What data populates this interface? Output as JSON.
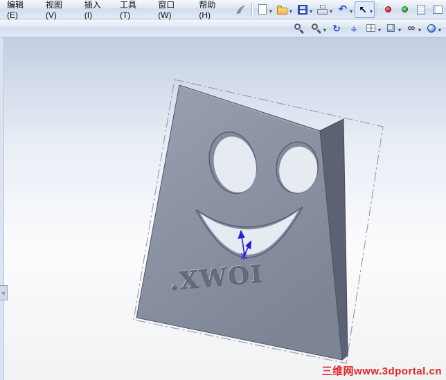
{
  "menu": {
    "items": [
      {
        "name": "menu-edit",
        "label": "编辑(E)"
      },
      {
        "name": "menu-view",
        "label": "视图(V)"
      },
      {
        "name": "menu-insert",
        "label": "插入(I)"
      },
      {
        "name": "menu-tools",
        "label": "工具(T)"
      },
      {
        "name": "menu-window",
        "label": "窗口(W)"
      },
      {
        "name": "menu-help",
        "label": "帮助(H)"
      }
    ]
  },
  "toolbar_main": {
    "group1": [
      {
        "name": "new-document-button",
        "icon": "new-document-icon",
        "cls": "g-page",
        "caret": "▾"
      },
      {
        "name": "open-button",
        "icon": "open-folder-icon",
        "cls": "g-folder",
        "caret": "▾"
      },
      {
        "name": "save-button",
        "icon": "save-floppy-icon",
        "cls": "g-floppy",
        "caret": "▾"
      },
      {
        "name": "print-button",
        "icon": "print-icon",
        "cls": "g-printer",
        "caret": "▾"
      },
      {
        "name": "undo-button",
        "icon": "undo-arrow-icon",
        "cls": "g-undo",
        "caret": "▾"
      },
      {
        "name": "select-button",
        "icon": "select-cursor-icon",
        "cls": "g-cursor",
        "caret": "▾",
        "state": "active"
      }
    ],
    "group2": [
      {
        "name": "rebuild-stop-button",
        "icon": "red-dot-icon",
        "cls": "g-reddot"
      },
      {
        "name": "rebuild-go-button",
        "icon": "green-dot-icon",
        "cls": "g-greendot"
      },
      {
        "name": "design-binder-button",
        "icon": "notebook-icon",
        "cls": "g-notebook"
      },
      {
        "name": "task-pane-button",
        "icon": "panel-icon",
        "cls": "g-panel"
      }
    ]
  },
  "toolbar_view": {
    "buttons": [
      {
        "name": "zoom-fit-button",
        "icon": "magnifier-icon",
        "cls": "g-mag"
      },
      {
        "name": "zoom-area-button",
        "icon": "magnifier-area-icon",
        "cls": "g-magarea",
        "caret": "▾"
      },
      {
        "name": "rotate-view-button",
        "icon": "rotate-view-icon",
        "cls": "g-rotate"
      },
      {
        "name": "pan-button",
        "icon": "pan-arrows-icon",
        "cls": "g-pan"
      },
      {
        "name": "view-orientation-button",
        "icon": "view-orientation-icon",
        "cls": "g-grid",
        "caret": "▾"
      },
      {
        "name": "display-style-button",
        "icon": "display-style-cube-icon",
        "cls": "g-cube",
        "caret": "▾"
      },
      {
        "name": "hide-show-items-button",
        "icon": "glasses-icon",
        "cls": "g-glasses",
        "caret": "▾"
      },
      {
        "name": "appearance-button",
        "icon": "appearance-ball-icon",
        "cls": "g-ball",
        "caret": "▾"
      }
    ]
  },
  "viewport": {
    "engraved_text": ".XWOI",
    "watermark": "三维网www.3dportal.cn"
  },
  "misc_icons": [
    "solidworks-logo-icon",
    "panel-collapse-toggle",
    "dropdown-caret"
  ],
  "colors": {
    "plate": "#8b92a4",
    "plate_side": "#5c6273",
    "viewport_top": "#c2cee3",
    "watermark_red": "#e82222",
    "accent_blue": "#2020d8"
  }
}
